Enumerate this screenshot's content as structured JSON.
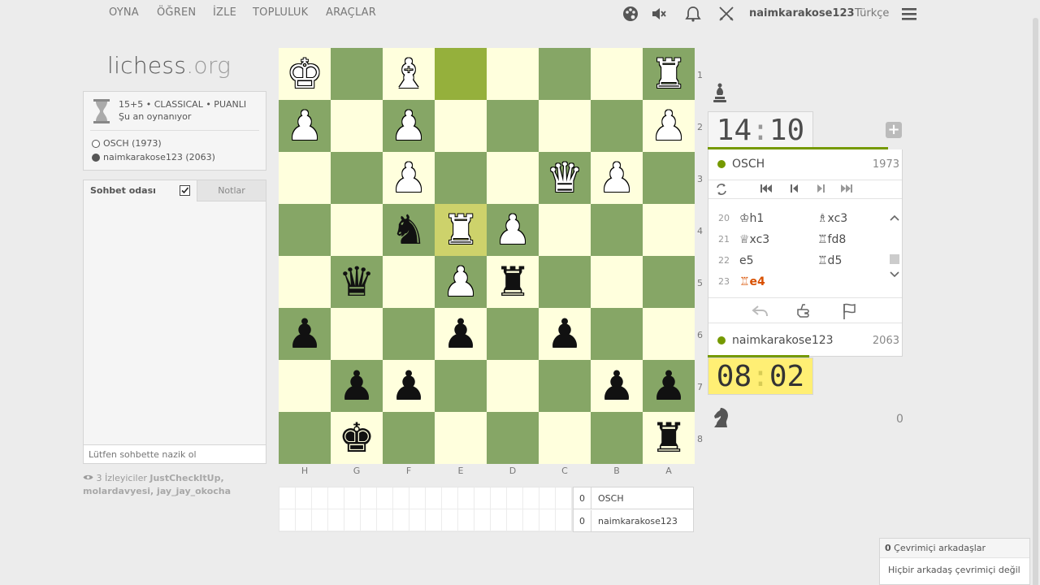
{
  "nav": {
    "items": [
      {
        "label": "OYNA"
      },
      {
        "label": "ÖĞREN"
      },
      {
        "label": "İZLE"
      },
      {
        "label": "TOPLULUK"
      },
      {
        "label": "ARAÇLAR"
      }
    ],
    "username": "naimkarakose123",
    "language": "Türkçe"
  },
  "logo": {
    "name": "lichess",
    "tld": ".org"
  },
  "game_info": {
    "setup": "15+5 • CLASSICAL • PUANLI",
    "status": "Şu an oynanıyor",
    "white_player": "OSCH (1973)",
    "black_player": "naimkarakose123 (2063)"
  },
  "chat": {
    "tab_chat": "Sohbet odası",
    "tab_notes": "Notlar",
    "placeholder": "Lütfen sohbette nazik ol"
  },
  "watchers": {
    "count_text": "3 İzleyiciler",
    "names": "JustCheckItUp, molardavyesi, jay_jay_okocha"
  },
  "board": {
    "ranks": [
      "1",
      "2",
      "3",
      "4",
      "5",
      "6",
      "7",
      "8"
    ],
    "files": [
      "H",
      "G",
      "F",
      "E",
      "D",
      "C",
      "B",
      "A"
    ],
    "squares": [
      [
        "wK",
        "",
        "wB",
        "hl",
        "",
        "",
        "",
        "wR"
      ],
      [
        "wP",
        "",
        "wP",
        "",
        "",
        "",
        "",
        "wP"
      ],
      [
        "",
        "",
        "wP",
        "",
        "",
        "wQ",
        "wP",
        ""
      ],
      [
        "",
        "",
        "bN",
        "wR*",
        "wP",
        "",
        "",
        ""
      ],
      [
        "",
        "bQ",
        "",
        "wP",
        "bR",
        "",
        "",
        ""
      ],
      [
        "bP",
        "",
        "",
        "bP",
        "",
        "bP",
        "",
        ""
      ],
      [
        "",
        "bP",
        "bP",
        "",
        "",
        "",
        "bP",
        "bP"
      ],
      [
        "",
        "bK",
        "",
        "",
        "",
        "",
        "",
        "bR"
      ]
    ]
  },
  "crosstable": {
    "rows": [
      {
        "score": "0",
        "name": "OSCH"
      },
      {
        "score": "0",
        "name": "naimkarakose123"
      }
    ]
  },
  "clocks": {
    "top": {
      "min": "14",
      "sec": "10"
    },
    "bottom": {
      "min": "08",
      "sec": "02"
    }
  },
  "players": {
    "top": {
      "name": "OSCH",
      "rating": "1973"
    },
    "bottom": {
      "name": "naimkarakose123",
      "rating": "2063"
    }
  },
  "moves": [
    {
      "n": "20",
      "w": "♔h1",
      "b": "♗xc3"
    },
    {
      "n": "21",
      "w": "♕xc3",
      "b": "♖fd8"
    },
    {
      "n": "22",
      "w": "e5",
      "b": "♖d5"
    },
    {
      "n": "23",
      "w": "♖e4",
      "b": ""
    }
  ],
  "material": {
    "bottom_score": "0"
  },
  "friends": {
    "count": "0",
    "header": "Çevrimiçi arkadaşlar",
    "empty": "Hiçbir arkadaş çevrimiçi değil"
  },
  "colors": {
    "accent": "#759900",
    "active_move": "#d85000",
    "clock_running": "#ffef74"
  }
}
